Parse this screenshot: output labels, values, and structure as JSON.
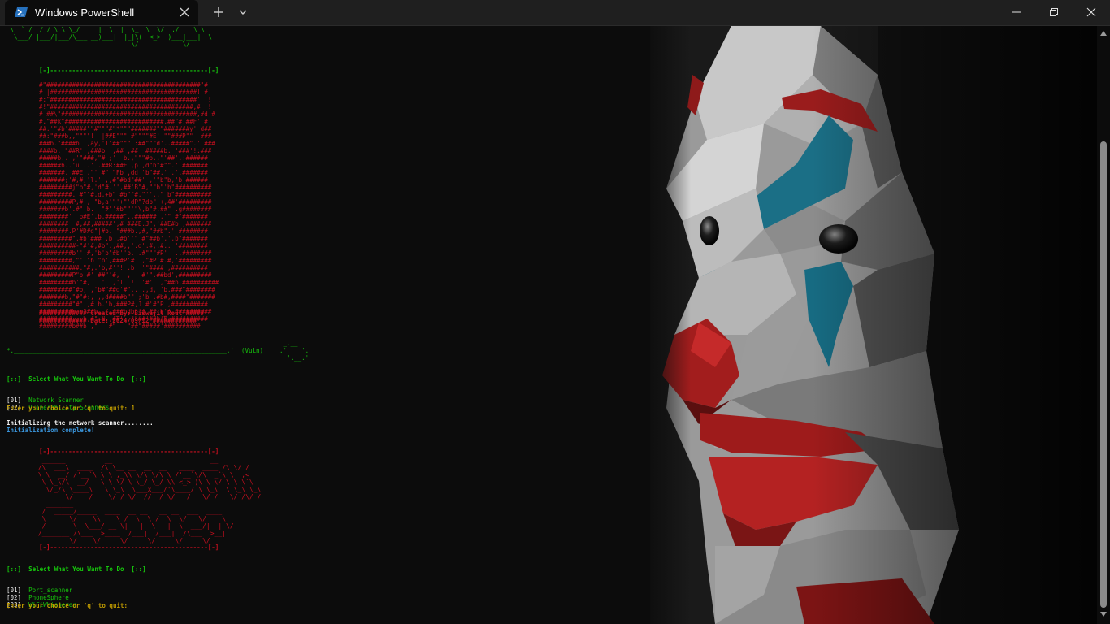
{
  "window": {
    "tab_title": "Windows PowerShell",
    "tab_icon": "powershell-icon",
    "new_tab_icon": "plus-icon",
    "dropdown_icon": "chevron-down-icon"
  },
  "colors": {
    "background": "#0c0c0c",
    "titlebar": "#1f1f1f",
    "green": "#16c60c",
    "red": "#c50f1f",
    "yellow": "#c19c00",
    "cyan": "#3a96dd",
    "white": "#f2f2f2"
  },
  "terminal": {
    "banner_divider": "[-]-------------------------------------------[-]",
    "created_by": "############# Created_by: Biswajit_Rout #####",
    "date": "############# Date: 2024/09/12 ############",
    "separator": "*.__________________________________________________________,'  (VuLn)",
    "menu1": {
      "header": "[::]  Select What You Want To Do  [::]",
      "options": [
        {
          "num": "[01]",
          "label": "Network Scanner"
        },
        {
          "num": "[02]",
          "label": "Vulnerability Scanners"
        }
      ],
      "prompt": "Enter your choice or 'q' to quit: 1"
    },
    "init_msg": "Initializing the network scanner........",
    "init_done": "Initialization complete!",
    "menu2": {
      "header": "[::]  Select What You Want To Do  [::]",
      "options": [
        {
          "num": "[01]",
          "label": "Port_scanner"
        },
        {
          "num": "[02]",
          "label": "PhoneSphere"
        },
        {
          "num": "[03]",
          "label": "WiFiWhisperer"
        }
      ],
      "prompt": "Enter your choice or 'q' to quit:"
    }
  }
}
